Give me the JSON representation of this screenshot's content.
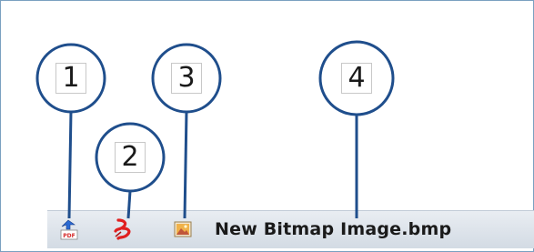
{
  "callouts": [
    {
      "number": "1",
      "target": "pdf-icon"
    },
    {
      "number": "2",
      "target": "split-icon"
    },
    {
      "number": "3",
      "target": "image-icon"
    },
    {
      "number": "4",
      "target": "file-name"
    }
  ],
  "toolbar": {
    "file_name": "New Bitmap Image.bmp",
    "icons": [
      "pdf-icon",
      "split-icon",
      "image-icon"
    ]
  },
  "colors": {
    "callout_stroke": "#1f4e8c",
    "frame_border": "#7aa0c0",
    "toolbar_bg": "#dfe5ec",
    "pdf_red": "#d42a2a",
    "split_red": "#e02020",
    "arrow_blue": "#2a6ad4"
  }
}
